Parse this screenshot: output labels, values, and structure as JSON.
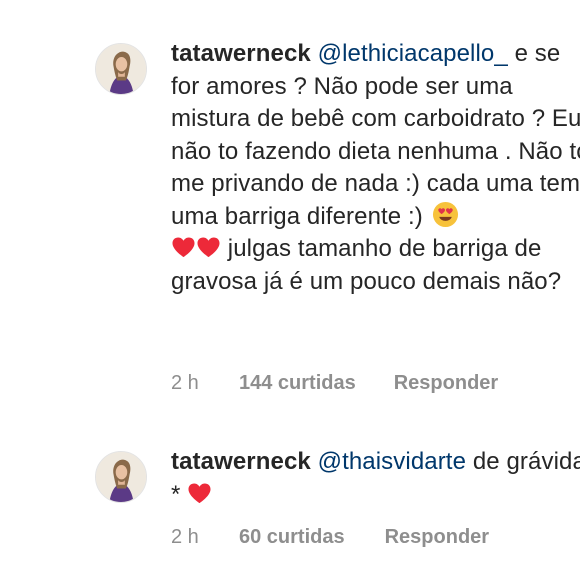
{
  "comments": [
    {
      "username": "tatawerneck",
      "mention": "@lethiciacapello_",
      "text_before_emoji": "e se for amores ? Não pode ser uma mistura de bebê com carboidrato ? Eu não to fazendo dieta nenhuma . Não to me privando de nada :) cada uma tem uma barriga diferente :)",
      "emojis": [
        "heart-eyes-emoji",
        "red-heart-emoji",
        "red-heart-emoji"
      ],
      "text_after_emoji": "julgas tamanho de barriga de gravosa já é um pouco demais não?",
      "time": "2 h",
      "likes": "144 curtidas",
      "reply_label": "Responder"
    },
    {
      "username": "tatawerneck",
      "mention": "@thaisvidarte",
      "text_before_emoji": "de grávida *",
      "emojis": [
        "red-heart-emoji"
      ],
      "time": "2 h",
      "likes": "60 curtidas",
      "reply_label": "Responder"
    }
  ],
  "colors": {
    "text": "#262626",
    "mention": "#00376b",
    "meta": "#8e8e8e",
    "heart": "#ed2939"
  }
}
